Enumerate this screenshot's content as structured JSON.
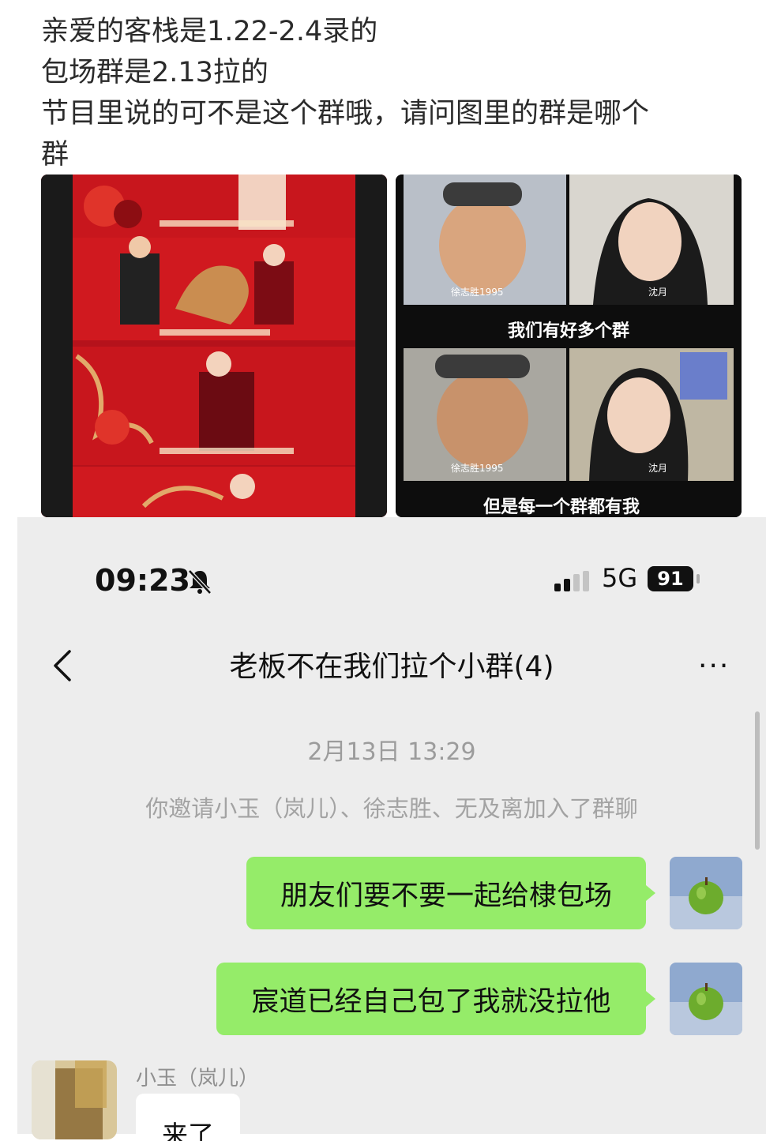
{
  "post": {
    "line1": "亲爱的客栈是1.22-2.4录的",
    "line2": "包场群是2.13拉的",
    "line3": "节目里说的可不是这个群哦，请问图里的群是哪个",
    "line4": "群"
  },
  "image_right": {
    "caption_top": "我们有好多个群",
    "caption_bottom": "但是每一个群都有我",
    "name_left": "徐志胜1995",
    "name_right": "沈月"
  },
  "status_bar": {
    "time": "09:23",
    "network": "5G",
    "battery": "91"
  },
  "chat": {
    "title": "老板不在我们拉个小群(4)",
    "more": "···",
    "timestamp": "2月13日 13:29",
    "system_message": "你邀请小玉（岚儿）、徐志胜、无及离加入了群聊",
    "messages": [
      {
        "from": "me",
        "text": "朋友们要不要一起给棣包场"
      },
      {
        "from": "me",
        "text": "宸道已经自己包了我就没拉他"
      },
      {
        "from": "小玉（岚儿）",
        "text": "来了"
      }
    ],
    "sender_name": "小玉（岚儿）"
  },
  "colors": {
    "bubble_green": "#95ec69",
    "chat_background": "#ededed",
    "festive_red": "#c8161d"
  }
}
